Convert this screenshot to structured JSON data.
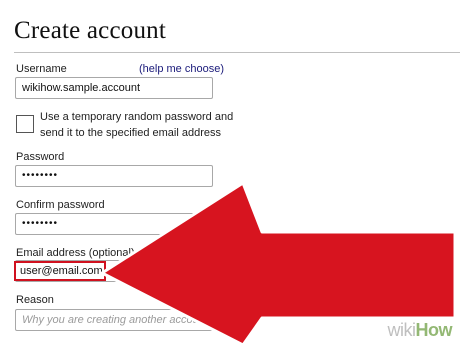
{
  "page": {
    "title": "Create account"
  },
  "form": {
    "username": {
      "label": "Username",
      "help_link": "(help me choose)",
      "value": "wikihow.sample.account"
    },
    "random_password": {
      "text": "Use a temporary random password and send it to the specified email address",
      "checked": false
    },
    "password": {
      "label": "Password",
      "value": "••••••••"
    },
    "confirm_password": {
      "label": "Confirm password",
      "value": "••••••••"
    },
    "email": {
      "label": "Email address (optional)",
      "value": "user@email.com"
    },
    "reason": {
      "label": "Reason",
      "placeholder": "Why you are creating another account"
    }
  },
  "annotation": {
    "arrow_color": "#d7141f",
    "arrow_outline": "#ffffff"
  },
  "watermark": {
    "part1": "wiki",
    "part2": "How"
  }
}
